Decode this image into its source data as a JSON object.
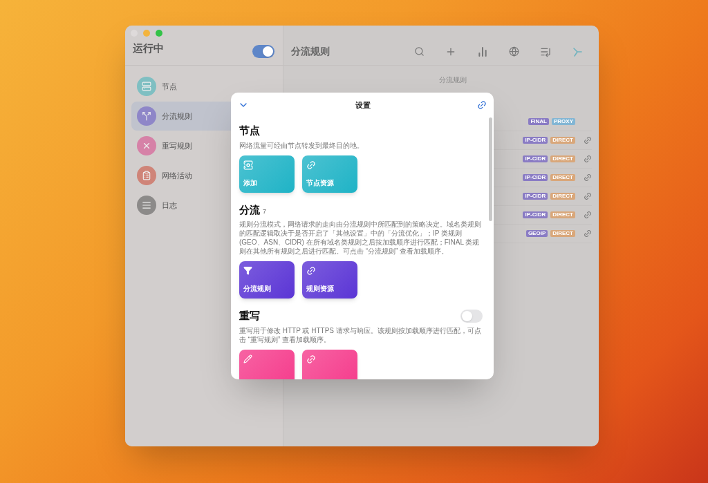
{
  "sidebar": {
    "title": "运行中",
    "toggle": {
      "on": true
    },
    "items": [
      {
        "label": "节点",
        "selected": false,
        "color": "#7fbfc2"
      },
      {
        "label": "分流规则",
        "selected": true,
        "color": "#8e86c8"
      },
      {
        "label": "重写规则",
        "selected": false,
        "color": "#d681a7"
      },
      {
        "label": "网络活动",
        "selected": false,
        "color": "#cf8478"
      },
      {
        "label": "日志",
        "selected": false,
        "color": "#8c8a89"
      }
    ]
  },
  "main": {
    "title": "分流规则",
    "section_label": "分流规则",
    "rows": [
      {
        "tags": [
          {
            "label": "FINAL",
            "color": "#8a7cc4"
          },
          {
            "label": "PROXY",
            "color": "#83b6d4"
          }
        ],
        "link": false
      },
      {
        "tags": [
          {
            "label": "IP-CIDR",
            "color": "#8a7cc4"
          },
          {
            "label": "DIRECT",
            "color": "#d9a77a"
          }
        ],
        "link": true
      },
      {
        "tags": [
          {
            "label": "IP-CIDR",
            "color": "#8a7cc4"
          },
          {
            "label": "DIRECT",
            "color": "#d9a77a"
          }
        ],
        "link": true
      },
      {
        "tags": [
          {
            "label": "IP-CIDR",
            "color": "#8a7cc4"
          },
          {
            "label": "DIRECT",
            "color": "#d9a77a"
          }
        ],
        "link": true
      },
      {
        "tags": [
          {
            "label": "IP-CIDR",
            "color": "#8a7cc4"
          },
          {
            "label": "DIRECT",
            "color": "#d9a77a"
          }
        ],
        "link": true
      },
      {
        "tags": [
          {
            "label": "IP-CIDR",
            "color": "#8a7cc4"
          },
          {
            "label": "DIRECT",
            "color": "#d9a77a"
          }
        ],
        "link": true
      },
      {
        "tags": [
          {
            "label": "GEOIP",
            "color": "#8a7cc4"
          },
          {
            "label": "DIRECT",
            "color": "#d9a77a"
          }
        ],
        "link": true
      }
    ]
  },
  "modal": {
    "title": "设置",
    "sections": [
      {
        "title": "节点",
        "description": "网络流量可经由节点转发到最终目的地。",
        "color": "#1fb3c6",
        "tiles": [
          {
            "kind": "add",
            "label": "添加"
          },
          {
            "kind": "link",
            "label": "节点资源"
          }
        ]
      },
      {
        "title": "分流",
        "count": "7",
        "description": "规则分流模式，网络请求的走向由分流规则中所匹配到的策略决定。域名类规则的匹配逻辑取决于是否开启了「其他设置」中的「分流优化」；IP 类规则 (GEO、ASN、CIDR) 在所有域名类规则之后按加载顺序进行匹配；FINAL 类规则在其他所有规则之后进行匹配。可点击 “分流规则” 查看加载顺序。",
        "color": "#5b35d5",
        "tiles": [
          {
            "kind": "filter",
            "label": "分流规则"
          },
          {
            "kind": "link",
            "label": "规则资源"
          }
        ]
      },
      {
        "title": "重写",
        "toggle": {
          "on": false
        },
        "description": "重写用于修改 HTTP 或 HTTPS 请求与响应。该规则按加载顺序进行匹配，可点击 “重写规则” 查看加载顺序。",
        "color": "#f53c8c",
        "tiles": [
          {
            "kind": "edit"
          },
          {
            "kind": "link"
          }
        ]
      }
    ]
  }
}
